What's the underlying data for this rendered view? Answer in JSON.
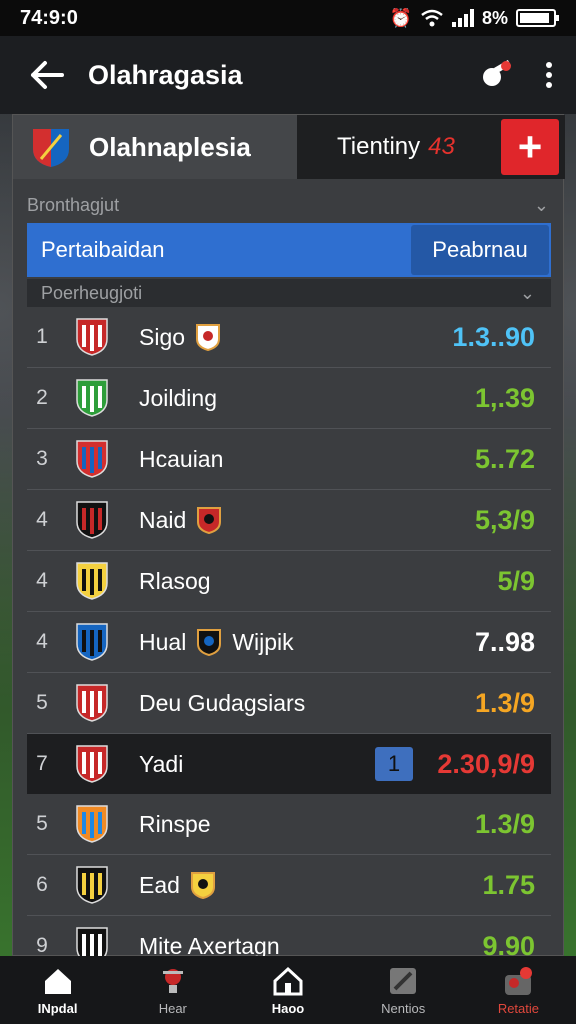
{
  "status": {
    "time": "74:9:0",
    "battery": "8%",
    "battery_level": 0.9
  },
  "appbar": {
    "title": "Olahragasia"
  },
  "header": {
    "club_name": "Olahnaplesia",
    "territory_label": "Tientiny",
    "territory_value": "43",
    "add_label": "+"
  },
  "section1": {
    "label": "Bronthagjut"
  },
  "tabs": {
    "left": "Pertaibaidan",
    "right": "Peabrnau"
  },
  "section2": {
    "label": "Poerheugjoti"
  },
  "rows": [
    {
      "rank": "1",
      "team": "Sigo",
      "extra": "",
      "value": "1.3..90",
      "color": "#4fc3f7",
      "crest": [
        "#c62828",
        "#fff"
      ],
      "mini": true
    },
    {
      "rank": "2",
      "team": "Joilding",
      "extra": "",
      "value": "1,.39",
      "color": "#7cc531",
      "crest": [
        "#2e9e3a",
        "#fff"
      ],
      "mini": false
    },
    {
      "rank": "3",
      "team": "Hcauian",
      "extra": "",
      "value": "5..72",
      "color": "#7cc531",
      "crest": [
        "#d32f2f",
        "#1565c0"
      ],
      "mini": false
    },
    {
      "rank": "4",
      "team": "Naid",
      "extra": "",
      "value": "5,3/9",
      "color": "#7cc531",
      "crest": [
        "#111",
        "#c62828"
      ],
      "mini": true
    },
    {
      "rank": "4",
      "team": "Rlasog",
      "extra": "",
      "value": "5/9",
      "color": "#7cc531",
      "crest": [
        "#f4d03f",
        "#111"
      ],
      "mini": false
    },
    {
      "rank": "4",
      "team": "Hual",
      "extra": "Wijpik",
      "value": "7..98",
      "color": "#ffffff",
      "crest": [
        "#1565c0",
        "#111"
      ],
      "mini": true
    },
    {
      "rank": "5",
      "team": "Deu Gudagsiars",
      "extra": "",
      "value": "1.3/9",
      "color": "#f5a623",
      "crest": [
        "#c62828",
        "#fff"
      ],
      "mini": false
    },
    {
      "rank": "7",
      "team": "Yadi",
      "extra": "",
      "value": "2.30,9/9",
      "color": "#e53935",
      "crest": [
        "#c62828",
        "#fff"
      ],
      "mini": false,
      "highlight": true,
      "badge": "1"
    },
    {
      "rank": "5",
      "team": "Rinspe",
      "extra": "",
      "value": "1.3/9",
      "color": "#7cc531",
      "crest": [
        "#f08a24",
        "#1e88e5"
      ],
      "mini": false
    },
    {
      "rank": "6",
      "team": "Ead",
      "extra": "",
      "value": "1.75",
      "color": "#7cc531",
      "crest": [
        "#111",
        "#f4d03f"
      ],
      "mini": true
    },
    {
      "rank": "9",
      "team": "Mite Axertagn",
      "extra": "",
      "value": "9.90",
      "color": "#7cc531",
      "crest": [
        "#111",
        "#fff"
      ],
      "mini": false
    }
  ],
  "nav": [
    {
      "label": "INpdal",
      "icon": "home-icon",
      "state": "active"
    },
    {
      "label": "Hear",
      "icon": "trophy-icon",
      "state": ""
    },
    {
      "label": "Haoo",
      "icon": "house-outline-icon",
      "state": "active"
    },
    {
      "label": "Nentios",
      "icon": "news-icon",
      "state": ""
    },
    {
      "label": "Retatie",
      "icon": "profile-alert-icon",
      "state": "red"
    }
  ]
}
